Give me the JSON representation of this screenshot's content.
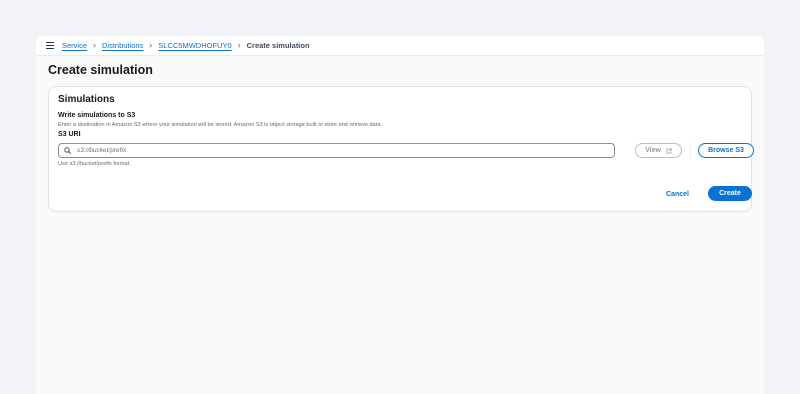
{
  "breadcrumb": {
    "items": [
      "Service",
      "Distributions",
      "SLCC5MWDHOFUY0"
    ],
    "current": "Create simulation"
  },
  "page": {
    "title": "Create simulation"
  },
  "panel": {
    "title": "Simulations",
    "field_label": "Write simulations to S3",
    "field_description": "Enter a destination in Amazon S3 where your simulation will be stored. Amazon S3 is object storage built to store and retrieve data.",
    "uri_label": "S3 URI",
    "uri_value": "",
    "uri_placeholder": "s3://bucket/prefix",
    "constraint": "Use s3://bucket/prefix format.",
    "view_label": "View",
    "browse_label": "Browse S3"
  },
  "actions": {
    "cancel_label": "Cancel",
    "create_label": "Create"
  },
  "colors": {
    "accent": "#0972d3",
    "page_bg": "#f2f3f7",
    "panel_bg": "#ffffff"
  },
  "icons": [
    "menu-icon",
    "chevron-right-icon",
    "search-icon",
    "external-link-icon"
  ]
}
